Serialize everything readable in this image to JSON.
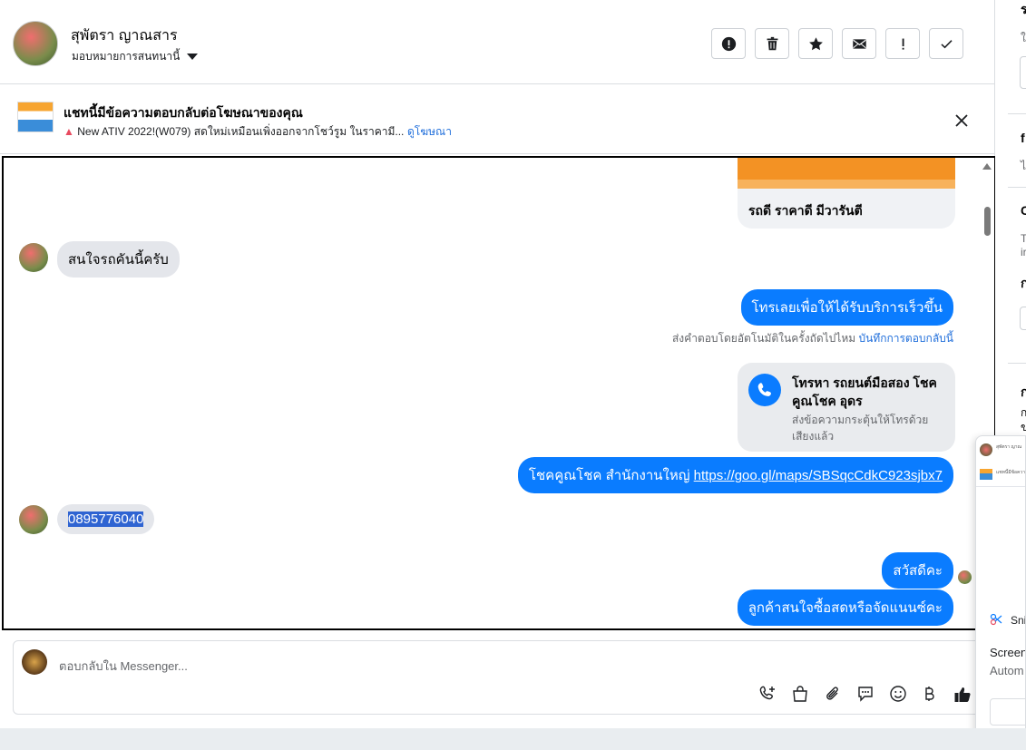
{
  "header": {
    "contact_name": "สุพัตรา ญาณสาร",
    "assign_label": "มอบหมายการสนทนานี้",
    "actions": [
      "report-icon",
      "delete-icon",
      "star-icon",
      "mail-icon",
      "exclamation-icon",
      "check-icon"
    ]
  },
  "ad_banner": {
    "title": "แชทนี้มีข้อความตอบกลับต่อโฆษณาของคุณ",
    "subtitle": "New ATIV 2022!(W079) สดใหม่เหมือนเพิ่งออกจากโชว์รูม ในราคามี...",
    "view_ad_label": "ดูโฆษณา"
  },
  "messages": {
    "card_caption": "รถดี ราคาดี มีวารันตี",
    "m1": "สนใจรถคันนี้ครับ",
    "m2": "โทรเลยเพื่อให้ได้รับบริการเร็วขึ้น",
    "hint_text": "ส่งคำตอบโดยอัตโนมัติในครั้งถัดไปไหม",
    "hint_link": "บันทึกการตอบกลับนี้",
    "call_title": "โทรหา รถยนต์มือสอง โชคคูณโชค อุดร",
    "call_sub": "ส่งข้อความกระตุ้นให้โทรด้วยเสียงแล้ว",
    "m3_prefix": "โชคคูณโชค สำนักงานใหญ่",
    "m3_link": "https://goo.gl/maps/SBSqcCdkC923sjbx7",
    "m4": "0895776040",
    "m5": "สวัสดีคะ",
    "m6": "ลูกค้าสนใจซื้อสดหรือจัดแนนซ์คะ"
  },
  "composer": {
    "placeholder": "ตอบกลับใน Messenger...",
    "icons": [
      "call-add-icon",
      "shop-bag-icon",
      "attach-icon",
      "chat-bubble-icon",
      "emoji-icon",
      "baht-icon",
      "like-icon"
    ]
  },
  "overlay": {
    "snip_label": "Sni",
    "line1": "Screen",
    "line2": "Autom"
  }
}
